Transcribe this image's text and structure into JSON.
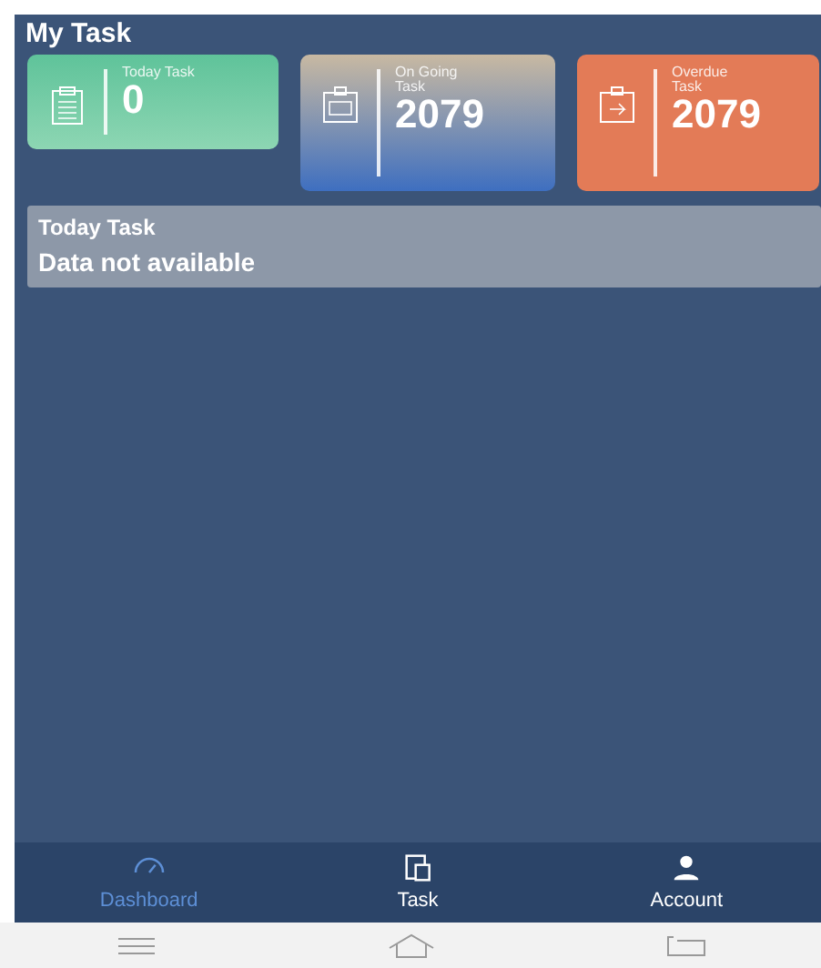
{
  "header": {
    "title": "My Task"
  },
  "stats": [
    {
      "label": "Today Task",
      "value": "0",
      "kind": "today"
    },
    {
      "label": "On Going Task",
      "value": "2079",
      "kind": "ongoing"
    },
    {
      "label": "Overdue Task",
      "value": "2079",
      "kind": "overdue"
    }
  ],
  "today_panel": {
    "title": "Today Task",
    "message": "Data not available"
  },
  "bottom_nav": [
    {
      "label": "Dashboard",
      "kind": "dashboard",
      "selected": true
    },
    {
      "label": "Task",
      "kind": "task",
      "selected": false
    },
    {
      "label": "Account",
      "kind": "account",
      "selected": false
    }
  ]
}
